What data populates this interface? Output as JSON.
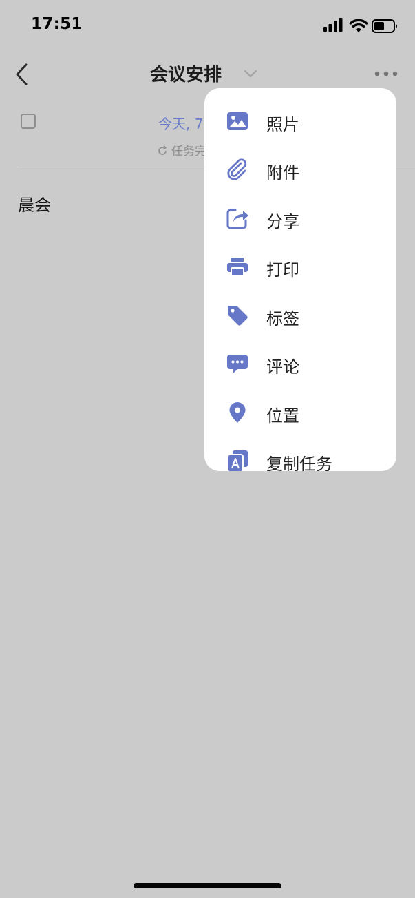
{
  "status_bar": {
    "time": "17:51",
    "icons": [
      "signal-icon",
      "wifi-icon",
      "battery-icon"
    ]
  },
  "nav": {
    "back_icon": "back-chevron-icon",
    "title": "会议安排",
    "title_dropdown_icon": "chevron-down-icon",
    "more_icon": "more-dots-icon"
  },
  "task": {
    "due_text": "今天, 7",
    "repeat_text": "任务完",
    "title": "晨会"
  },
  "menu": {
    "items": [
      {
        "label": "照片",
        "icon": "image-icon"
      },
      {
        "label": "附件",
        "icon": "paperclip-icon"
      },
      {
        "label": "分享",
        "icon": "share-icon"
      },
      {
        "label": "打印",
        "icon": "printer-icon"
      },
      {
        "label": "标签",
        "icon": "tag-icon"
      },
      {
        "label": "评论",
        "icon": "comment-icon"
      },
      {
        "label": "位置",
        "icon": "location-icon"
      },
      {
        "label": "复制任务",
        "icon": "duplicate-icon"
      }
    ]
  },
  "colors": {
    "accent": "#6a7cc9",
    "icon": "#6677c8",
    "background": "#cbcbcb",
    "menu_background": "#ffffff"
  }
}
